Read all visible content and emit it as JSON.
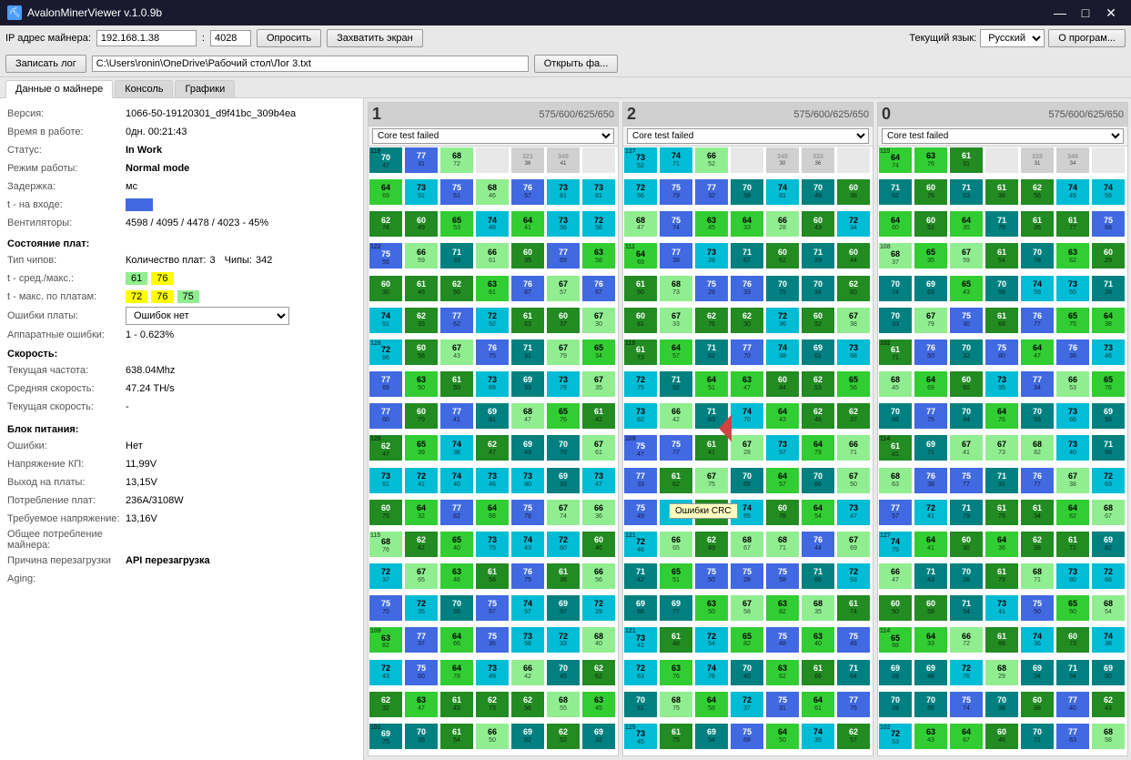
{
  "window": {
    "title": "AvalonMinerViewer v.1.0.9b",
    "minimize": "—",
    "maximize": "□",
    "close": "✕"
  },
  "toolbar": {
    "ip_label": "IP адрес майнера:",
    "ip_value": "192.168.1.38",
    "port_value": "4028",
    "poll_btn": "Опросить",
    "capture_btn": "Захватить экран",
    "log_btn": "Записать лог",
    "log_path": "C:\\Users\\ronin\\OneDrive\\Рабочий стол\\Лог 3.txt",
    "open_file_btn": "Открыть фа...",
    "lang_label": "Текущий язык:",
    "lang_value": "Русский",
    "about_btn": "О програм..."
  },
  "tabs": [
    "Данные о майнере",
    "Консоль",
    "Графики"
  ],
  "active_tab": 0,
  "info": {
    "version_label": "Версия:",
    "version_value": "1066-50-19120301_d9f41bc_309b4ea",
    "uptime_label": "Время в работе:",
    "uptime_value": "0дн. 00:21:43",
    "status_label": "Статус:",
    "status_value": "In Work",
    "mode_label": "Режим работы:",
    "mode_value": "Normal mode",
    "delay_label": "Задержка:",
    "delay_value": "мс",
    "input_label": "t - на входе:",
    "fans_label": "Вентиляторы:",
    "fans_value": "4598 / 4095 / 4478 / 4023 - 45%",
    "boards_title": "Состояние плат:",
    "board_type_label": "Тип чипов:",
    "board_type_value": "Количество плат:",
    "boards_count": "3",
    "chips_label": "Чипы:",
    "chips_count": "342",
    "temp_avg_label": "t - сред./макс.:",
    "temp_avg_val1": "61",
    "temp_avg_val2": "76",
    "temp_max_label": "t - макс. по платам:",
    "temp_max_val1": "72",
    "temp_max_val2": "76",
    "temp_max_val3": "75",
    "errors_label": "Ошибки платы:",
    "errors_value": "Ошибок нет",
    "hw_errors_label": "Аппаратные ошибки:",
    "hw_errors_value": "1 - 0.623%",
    "speed_title": "Скорость:",
    "cur_freq_label": "Текущая частота:",
    "cur_freq_value": "638.04Mhz",
    "avg_speed_label": "Средняя скорость:",
    "avg_speed_value": "47.24 TH/s",
    "cur_speed_label": "Текущая скорость:",
    "cur_speed_value": "-",
    "psu_title": "Блок питания:",
    "psu_errors_label": "Ошибки:",
    "psu_errors_value": "Нет",
    "psu_voltage_label": "Напряжение КП:",
    "psu_voltage_value": "11,99V",
    "psu_output_label": "Выход на платы:",
    "psu_output_value": "13,15V",
    "psu_consumption_label": "Потребление плат:",
    "psu_consumption_value": "236А/3108W",
    "psu_required_label": "Требуемое напряжение:",
    "psu_required_value": "13,16V",
    "total_consumption_label": "Общее потребление майнера:",
    "reboot_label": "Причина перезагрузки",
    "reboot_value": "API перезагрузка",
    "aging_label": "Aging:"
  },
  "boards": [
    {
      "num": "1",
      "freq": "575/600/625/650",
      "status": "Core test failed"
    },
    {
      "num": "2",
      "freq": "575/600/625/650",
      "status": "Core test failed"
    },
    {
      "num": "0",
      "freq": "575/600/625/650",
      "status": "Core test failed"
    }
  ],
  "crc_tooltip": "Ошибки CRC"
}
